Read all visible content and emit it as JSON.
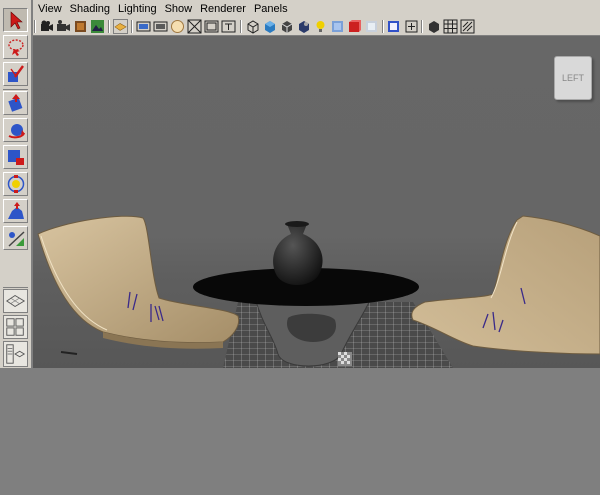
{
  "menu": {
    "items": [
      "View",
      "Shading",
      "Lighting",
      "Show",
      "Renderer",
      "Panels"
    ]
  },
  "toolbox": {
    "tools": [
      {
        "icon": "select-arrow-icon",
        "active": true
      },
      {
        "icon": "lasso-select-icon",
        "active": false
      },
      {
        "icon": "paint-select-icon",
        "active": false
      },
      {
        "icon": "move-tool-icon",
        "active": false
      },
      {
        "icon": "rotate-tool-icon",
        "active": false
      },
      {
        "icon": "scale-tool-icon",
        "active": false
      },
      {
        "icon": "universal-manipulator-icon",
        "active": false
      },
      {
        "icon": "soft-modification-icon",
        "active": false
      },
      {
        "icon": "show-manipulator-icon",
        "active": false
      }
    ]
  },
  "viewport": {
    "viewcube_label": "LEFT"
  },
  "colors": {
    "chrome": "#d4d0c8",
    "viewport_bg": "#666666",
    "chair": "#c2ab86",
    "table_top": "#0a0a0a",
    "table_base": "#5e5e5e"
  }
}
